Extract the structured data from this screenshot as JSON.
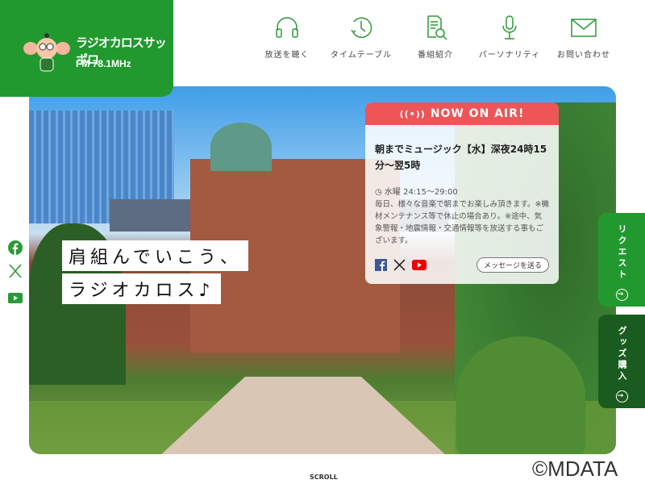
{
  "logo": {
    "name": "ラジオカロスサッポロ",
    "frequency": "FM 78.1MHz"
  },
  "nav": [
    {
      "label": "放送を聴く",
      "icon": "headphones-icon"
    },
    {
      "label": "タイムテーブル",
      "icon": "clock-icon"
    },
    {
      "label": "番組紹介",
      "icon": "document-search-icon"
    },
    {
      "label": "パーソナリティ",
      "icon": "microphone-icon"
    },
    {
      "label": "お問い合わせ",
      "icon": "mail-icon"
    }
  ],
  "hero": {
    "catch1": "肩組んでいこう、",
    "catch2": "ラジオカロス♪"
  },
  "onair": {
    "header": "NOW ON AIR!",
    "title": "朝までミュージック【水】深夜24時15分～翌5時",
    "time": "水曜 24:15～29:00",
    "description": "毎日、様々な音楽で朝までお楽しみ頂きます。※機材メンテナンス等で休止の場合あり。※途中、気象警報・地震情報・交通情報等を放送する事もございます。",
    "message_button": "メッセージを送る"
  },
  "side": {
    "request": "リクエスト",
    "goods": "グッズ購入"
  },
  "scroll": "SCROLL",
  "watermark": "©MDATA",
  "colors": {
    "brand": "#22992f",
    "onair": "#ed5557",
    "goods": "#1a5c1f"
  }
}
